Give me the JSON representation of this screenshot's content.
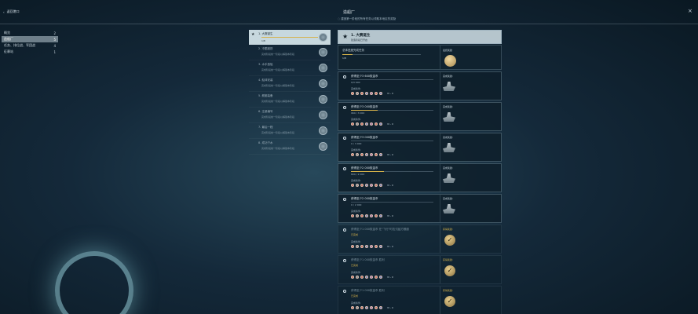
{
  "header": {
    "back_label": "返回港口",
    "title": "造船厂",
    "subtitle": "建造第一阶段的所有任务以领取本地区的奖励"
  },
  "menu": [
    {
      "label": "概览",
      "count": "2"
    },
    {
      "label": "造船厂",
      "count": "5"
    },
    {
      "label": "任务、排位战、军团战",
      "count": "4"
    },
    {
      "label": "征募站",
      "count": "1"
    }
  ],
  "stages": [
    {
      "num": "1.",
      "title": "大赛诞生",
      "count": "1/8",
      "active": true
    },
    {
      "num": "2.",
      "title": "冷酷锻铁",
      "sub": "完成阶段前一阶段以解锁本阶段",
      "active": false
    },
    {
      "num": "3.",
      "title": "水手造船",
      "sub": "完成阶段前一阶段以解锁本阶段",
      "active": false
    },
    {
      "num": "4.",
      "title": "船体安装",
      "sub": "完成阶段前一阶段以解锁本阶段",
      "active": false
    },
    {
      "num": "5.",
      "title": "舰艇装备",
      "sub": "完成阶段前一阶段以解锁本阶段",
      "active": false
    },
    {
      "num": "6.",
      "title": "注册编号",
      "sub": "完成阶段前一阶段以解锁本阶段",
      "active": false
    },
    {
      "num": "7.",
      "title": "最后一程",
      "sub": "完成阶段前一阶段以解锁本阶段",
      "active": false
    },
    {
      "num": "8.",
      "title": "成功下水",
      "sub": "完成阶段前一阶段以解锁本阶段",
      "active": false
    }
  ],
  "panel": {
    "title": "1. 大赛诞生",
    "subtitle": "建造阶段已开启",
    "overall_label": "总体进度完成任务",
    "overall_value": "1/8",
    "overall_progress": 0.125,
    "reward_label": "最终奖励"
  },
  "tasks": [
    {
      "title": "获得至少3 600枚金币",
      "value": "0/3 600",
      "progress": 0.0,
      "cond_label": "完成条件:",
      "extra": "VI - X",
      "reward_label": "完成奖励:",
      "done": false
    },
    {
      "title": "获得至少3 000枚金币",
      "value": "960 / 3 000",
      "progress": 0.32,
      "cond_label": "完成条件:",
      "extra": "VI - X",
      "reward_label": "完成奖励:",
      "done": false
    },
    {
      "title": "获得至少3 000枚金币",
      "value": "0 / 3 000",
      "progress": 0.0,
      "cond_label": "完成条件:",
      "extra": "VI - X",
      "reward_label": "完成奖励:",
      "done": false
    },
    {
      "title": "获得至少2 000枚金币",
      "value": "800 / 2 000",
      "progress": 0.4,
      "cond_label": "完成条件:",
      "extra": "VI - X",
      "reward_label": "完成奖励:",
      "done": false
    },
    {
      "title": "获得至少2 000枚金币",
      "value": "0 / 2 000",
      "progress": 0.0,
      "cond_label": "完成条件:",
      "extra": "VI - X",
      "reward_label": "完成奖励:",
      "done": false
    },
    {
      "title": "获得至少1 000枚金币 在\"飞行\"时击沉敌方舰艇",
      "sub": "已完成",
      "cond_label": "完成条件:",
      "extra": "VI - X",
      "reward_label": "获得奖励:",
      "done": true
    },
    {
      "title": "获得至少1 000枚金币 胜利",
      "sub": "已完成",
      "cond_label": "完成条件:",
      "extra": "VI - X",
      "reward_label": "获得奖励:",
      "done": true
    },
    {
      "title": "获得至少1 000枚金币 胜利",
      "sub": "已完成",
      "cond_label": "完成条件:",
      "extra": "VI - X",
      "reward_label": "获得奖励:",
      "done": true
    }
  ]
}
